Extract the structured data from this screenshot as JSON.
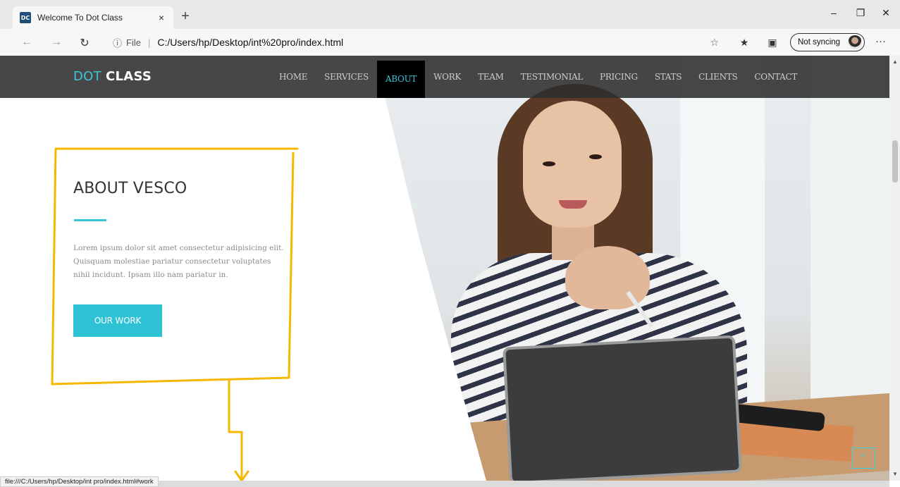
{
  "browser": {
    "tab_title": "Welcome To Dot Class",
    "favicon_text": "DC",
    "close_tab_glyph": "×",
    "new_tab_glyph": "+",
    "address": {
      "security_label": "File",
      "url": "C:/Users/hp/Desktop/int%20pro/index.html"
    },
    "sync_label": "Not syncing",
    "status_url": "file:///C:/Users/hp/Desktop/int pro/index.html#work"
  },
  "site": {
    "brand_part1": "DOT",
    "brand_part2": "CLASS",
    "nav": [
      "HOME",
      "SERVICES",
      "ABOUT",
      "WORK",
      "TEAM",
      "TESTIMONIAL",
      "PRICING",
      "STATS",
      "CLIENTS",
      "CONTACT"
    ],
    "active_nav": "ABOUT",
    "about": {
      "title": "ABOUT VESCO",
      "text": "Lorem ipsum dolor sit amet consectetur adipisicing elit. Quisquam molestiae pariatur consectetur voluptates nihil incidunt. Ipsam illo nam pariatur in.",
      "button": "OUR WORK"
    }
  },
  "colors": {
    "accent": "#2ec3d4",
    "annotation": "#f5b800",
    "nav_bg": "#2d2d2d"
  },
  "icons": {
    "back": "arrow-left-icon",
    "forward": "arrow-right-icon",
    "refresh": "refresh-icon",
    "info": "info-icon",
    "favorite": "star-icon",
    "favorites_list": "favorites-icon",
    "collections": "collections-icon",
    "more": "more-icon",
    "scroll_top": "chevron-up-icon"
  }
}
